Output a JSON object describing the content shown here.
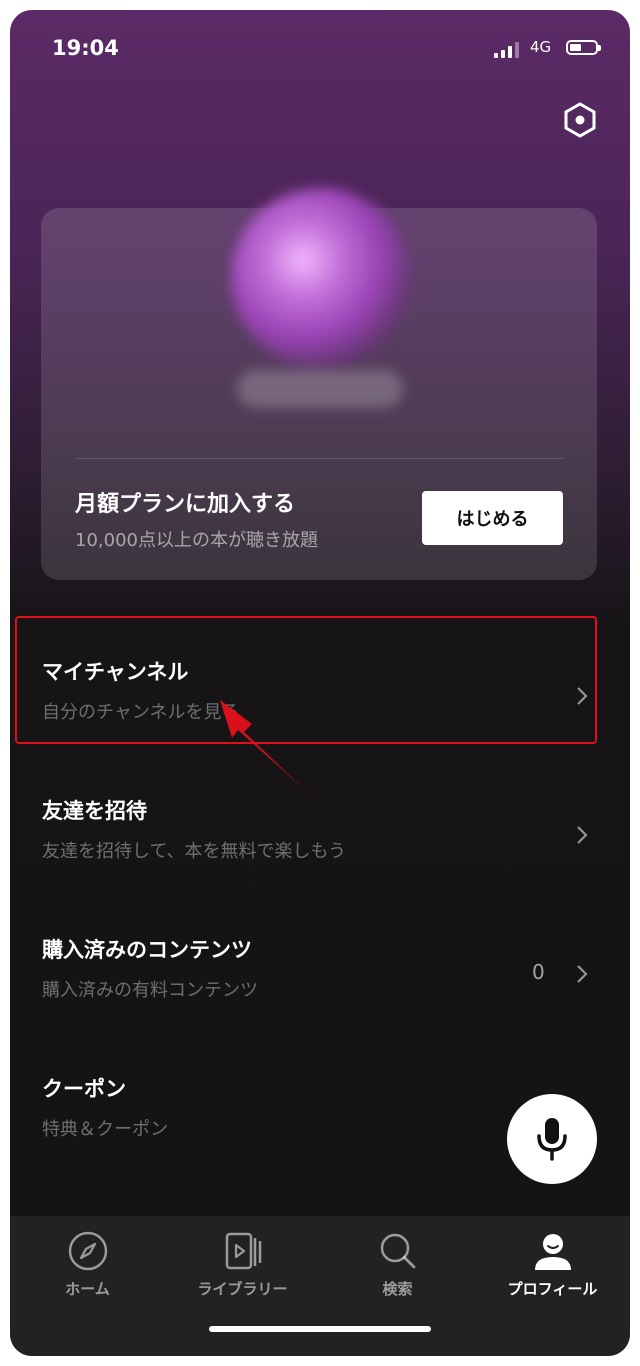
{
  "status_bar": {
    "time": "19:04",
    "network": "4G"
  },
  "plan_card": {
    "title": "月額プランに加入する",
    "subtitle": "10,000点以上の本が聴き放題",
    "button_label": "はじめる"
  },
  "menu": [
    {
      "title": "マイチャンネル",
      "subtitle": "自分のチャンネルを見る"
    },
    {
      "title": "友達を招待",
      "subtitle": "友達を招待して、本を無料で楽しもう"
    },
    {
      "title": "購入済みのコンテンツ",
      "subtitle": "購入済みの有料コンテンツ",
      "count": "0"
    },
    {
      "title": "クーポン",
      "subtitle": "特典＆クーポン"
    }
  ],
  "tabs": [
    {
      "label": "ホーム",
      "icon": "compass-icon"
    },
    {
      "label": "ライブラリー",
      "icon": "library-icon"
    },
    {
      "label": "検索",
      "icon": "search-icon"
    },
    {
      "label": "プロフィール",
      "icon": "profile-icon",
      "active": true
    }
  ],
  "colors": {
    "accent_purple": "#5b2a66",
    "highlight_red": "#e0101a",
    "background": "#141414"
  }
}
